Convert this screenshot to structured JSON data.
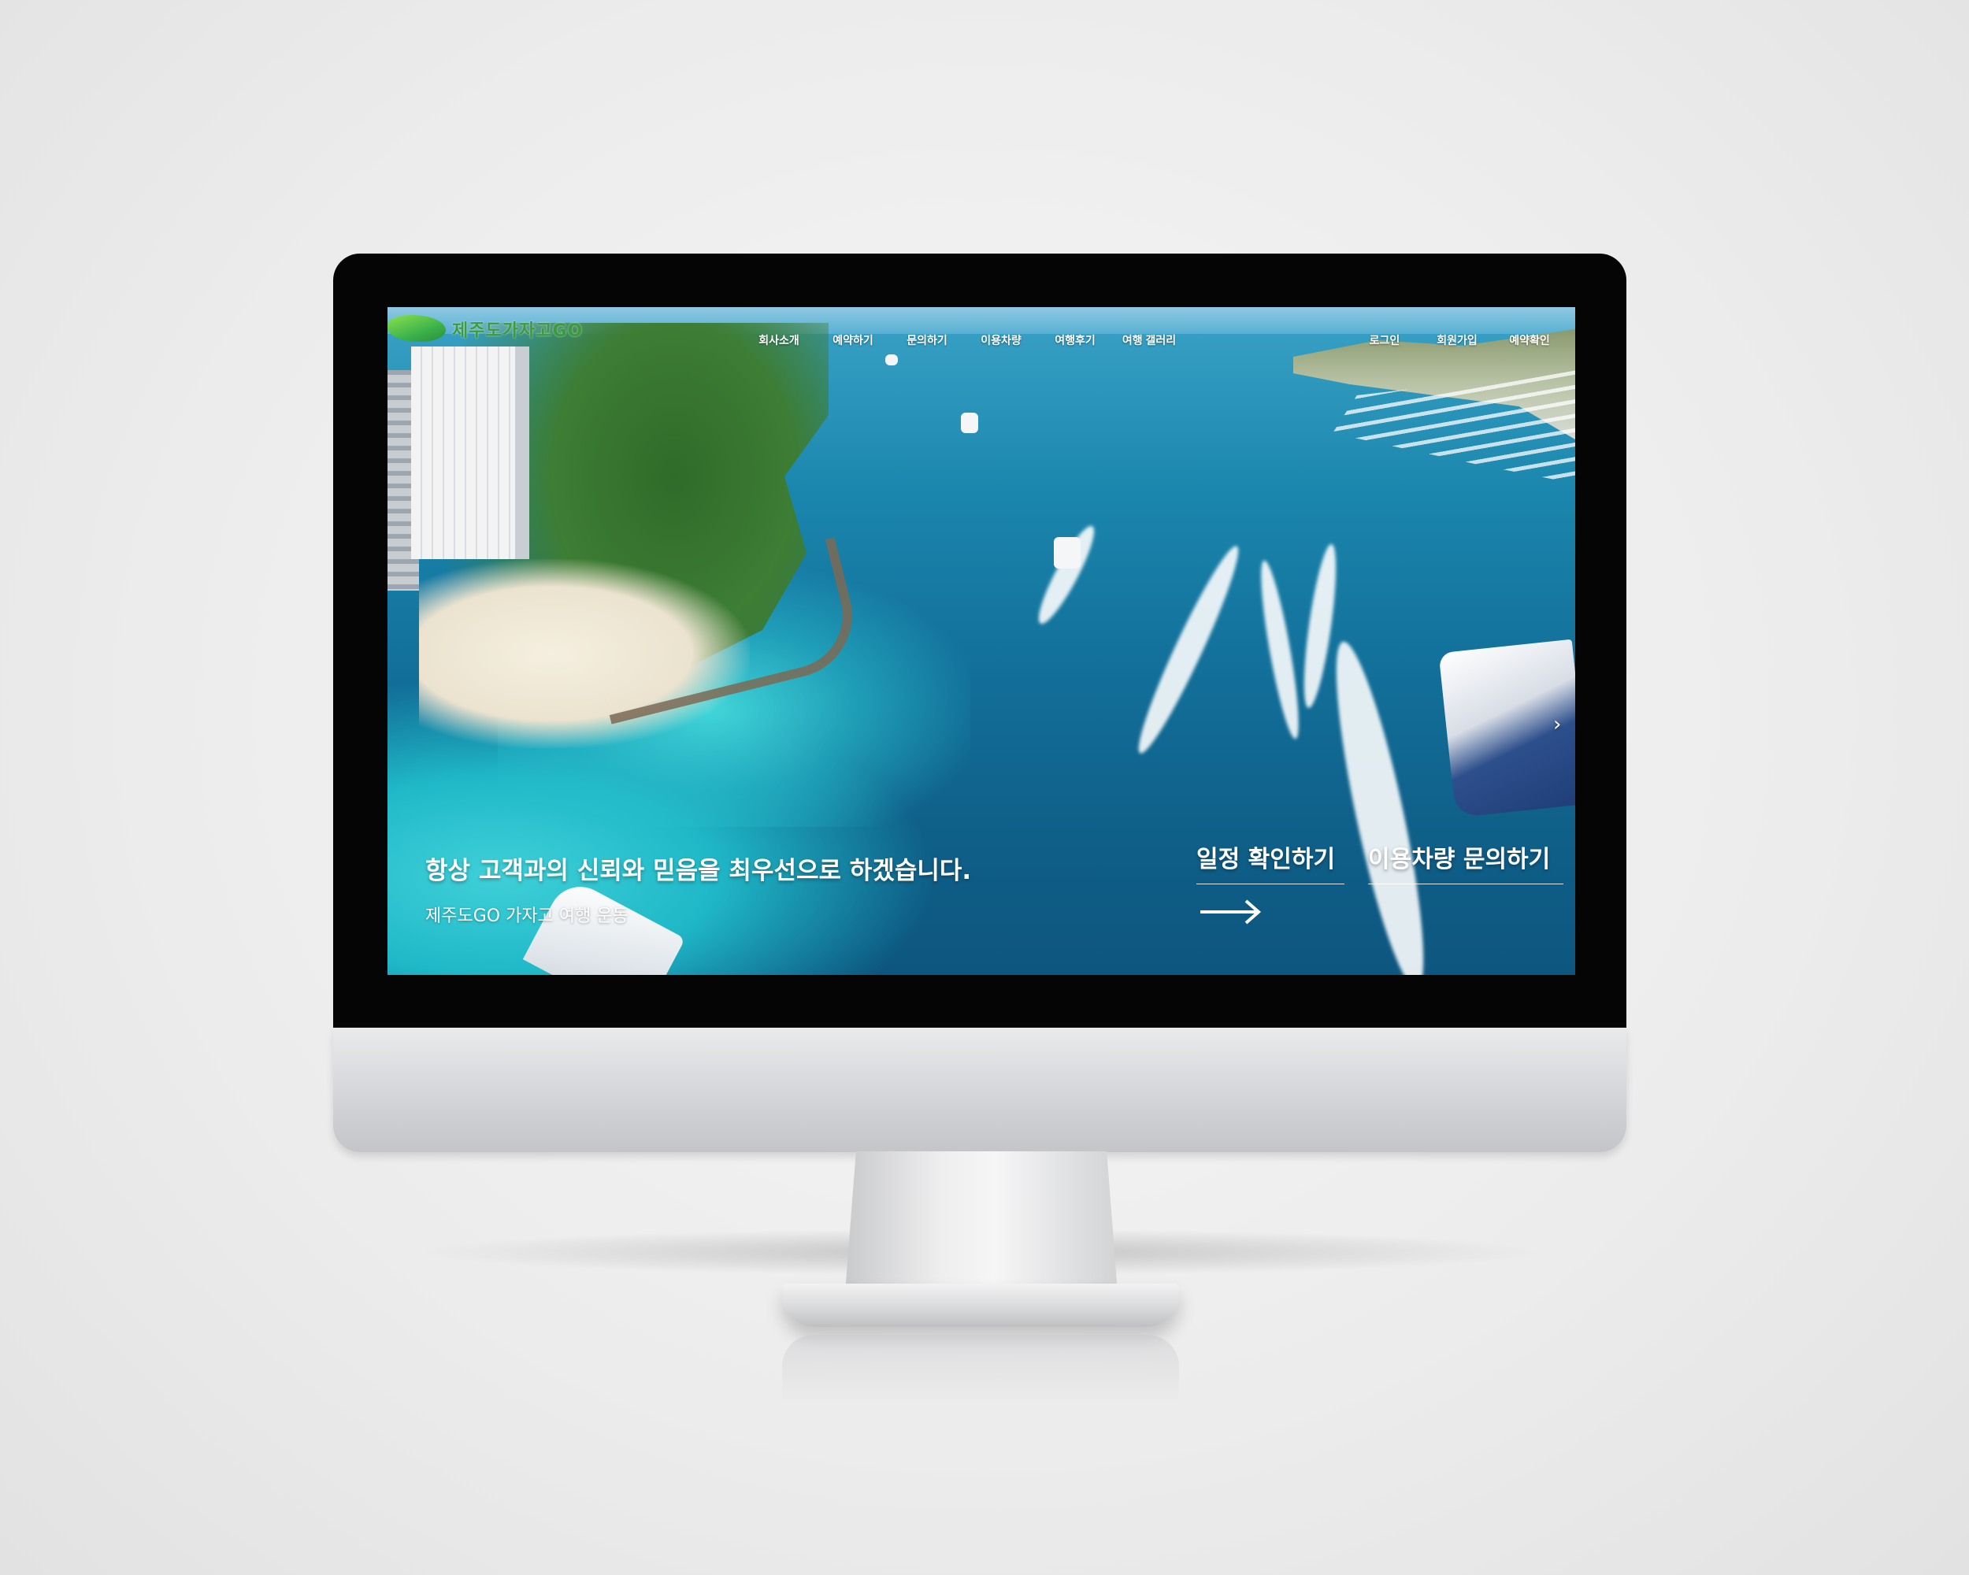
{
  "logo": {
    "text": "제주도가자고GO",
    "sub": ""
  },
  "nav": {
    "menu": [
      "회사소개",
      "예약하기",
      "문의하기",
      "이용차량",
      "여행후기",
      "여행 갤러리"
    ],
    "util": [
      "로그인",
      "회원가입",
      "예약확인"
    ]
  },
  "hero": {
    "title": "항상 고객과의 신뢰와 믿음을 최우선으로 하겠습니다.",
    "subtitle": "제주도GO 가자고 여행 운동",
    "cta_schedule": "일정 확인하기",
    "cta_vehicle": "이용차량 문의하기",
    "arrow_icon": "arrow-right-icon",
    "next_icon": "chevron-right-icon"
  },
  "colors": {
    "logo_green": "#3a9b3f",
    "sea": "#126f99"
  }
}
